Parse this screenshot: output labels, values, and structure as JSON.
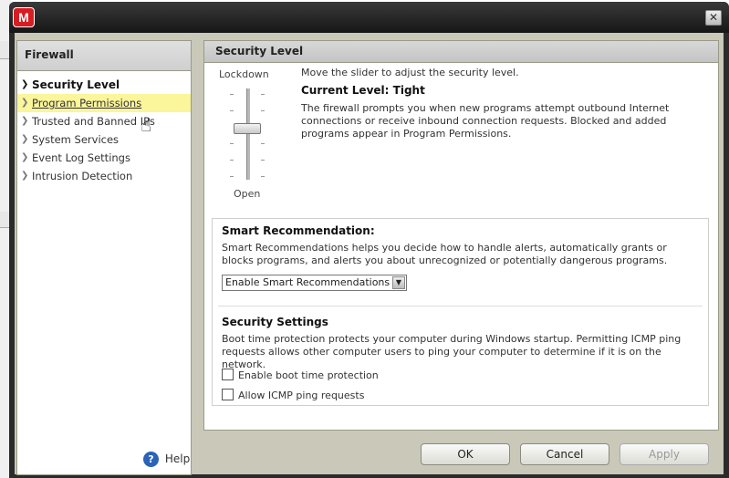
{
  "window": {
    "logo_letter": "M",
    "close_glyph": "✕"
  },
  "sidebar": {
    "header": "Firewall",
    "items": [
      {
        "label": "Security Level"
      },
      {
        "label": "Program Permissions"
      },
      {
        "label": "Trusted and Banned IPs"
      },
      {
        "label": "System Services"
      },
      {
        "label": "Event Log Settings"
      },
      {
        "label": "Intrusion Detection"
      }
    ],
    "help_label": "Help",
    "help_icon": "?"
  },
  "main": {
    "header": "Security Level",
    "slider": {
      "top_label": "Lockdown",
      "bottom_label": "Open"
    },
    "instruction": "Move the slider to adjust the security level.",
    "current_level_label": "Current Level:",
    "current_level_value": "Tight",
    "level_description": "The firewall prompts you when new programs attempt outbound Internet connections or receive inbound connection requests. Blocked and added programs appear in Program Permissions.",
    "smart": {
      "title": "Smart Recommendation:",
      "description": "Smart Recommendations helps you decide how to handle alerts, automatically grants or blocks programs, and alerts you about unrecognized or potentially dangerous programs.",
      "selected": "Enable Smart Recommendations"
    },
    "security": {
      "title": "Security Settings",
      "description": "Boot time protection protects your computer during Windows startup. Permitting ICMP ping requests allows other computer users to ping your computer to determine if it is on the network.",
      "boot_label": "Enable boot time protection",
      "icmp_label": "Allow ICMP ping requests"
    }
  },
  "buttons": {
    "ok": "OK",
    "cancel": "Cancel",
    "apply": "Apply"
  },
  "colors": {
    "brand_red": "#d81c22",
    "hover_yellow": "#fbf59c",
    "panel_bg": "#c9c8b9"
  }
}
